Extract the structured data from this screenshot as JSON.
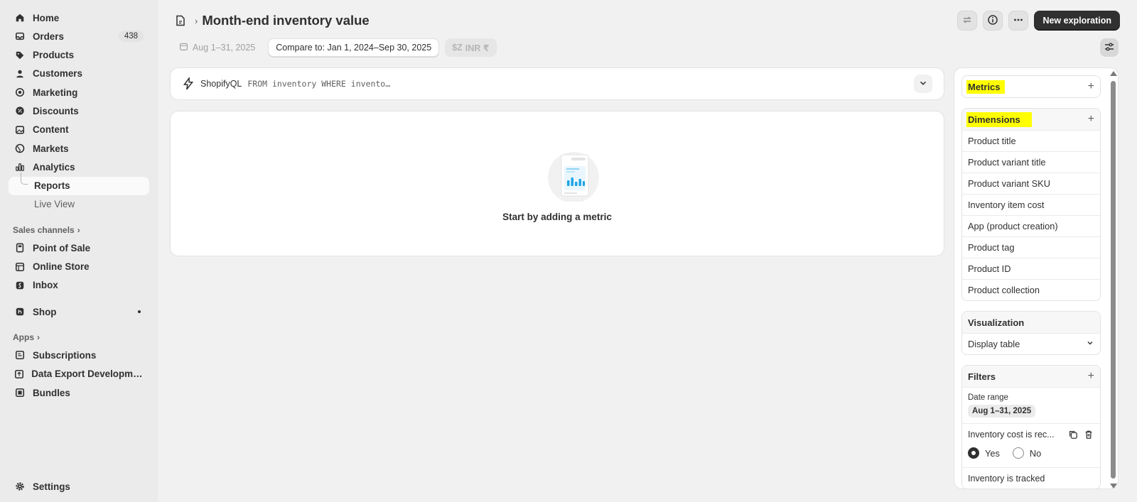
{
  "sidebar": {
    "nav": [
      {
        "label": "Home",
        "icon": "home-icon"
      },
      {
        "label": "Orders",
        "icon": "inbox-icon",
        "badge": "438"
      },
      {
        "label": "Products",
        "icon": "tag-icon"
      },
      {
        "label": "Customers",
        "icon": "person-icon"
      },
      {
        "label": "Marketing",
        "icon": "target-icon"
      },
      {
        "label": "Discounts",
        "icon": "discount-icon"
      },
      {
        "label": "Content",
        "icon": "image-icon"
      },
      {
        "label": "Markets",
        "icon": "globe-icon"
      },
      {
        "label": "Analytics",
        "icon": "bar-chart-icon"
      }
    ],
    "analytics_sub": [
      {
        "label": "Reports"
      },
      {
        "label": "Live View"
      }
    ],
    "sales_channels_title": "Sales channels",
    "channels": [
      {
        "label": "Point of Sale",
        "icon": "pos-icon"
      },
      {
        "label": "Online Store",
        "icon": "store-icon"
      },
      {
        "label": "Inbox",
        "icon": "inbox-app-icon"
      }
    ],
    "shop": {
      "label": "Shop",
      "icon": "shop-icon"
    },
    "apps_title": "Apps",
    "apps": [
      {
        "label": "Subscriptions",
        "icon": "app-icon"
      },
      {
        "label": "Data Export Development ...",
        "icon": "app-icon"
      },
      {
        "label": "Bundles",
        "icon": "app-icon"
      }
    ],
    "settings_label": "Settings"
  },
  "header": {
    "title": "Month-end inventory value",
    "separator": "›",
    "new_exploration_label": "New exploration"
  },
  "filters": {
    "date_range": "Aug 1–31, 2025",
    "compare": "Compare to: Jan 1, 2024–Sep 30, 2025",
    "currency": "INR ₹"
  },
  "query": {
    "brand": "ShopifyQL",
    "code": "FROM inventory WHERE invento…"
  },
  "empty_state": {
    "message": "Start by adding a metric"
  },
  "panel": {
    "metrics_title": "Metrics",
    "dimensions_title": "Dimensions",
    "dimensions": [
      "Product title",
      "Product variant title",
      "Product variant SKU",
      "Inventory item cost",
      "App (product creation)",
      "Product tag",
      "Product ID",
      "Product collection"
    ],
    "visualization_title": "Visualization",
    "visualization_value": "Display table",
    "filters_title": "Filters",
    "date_range_label": "Date range",
    "date_range_value": "Aug 1–31, 2025",
    "filter_1": "Inventory cost is rec...",
    "yes_label": "Yes",
    "no_label": "No",
    "filter_2": "Inventory is tracked"
  },
  "colors": {
    "highlight": "#ffff00",
    "primary": "#303030"
  }
}
